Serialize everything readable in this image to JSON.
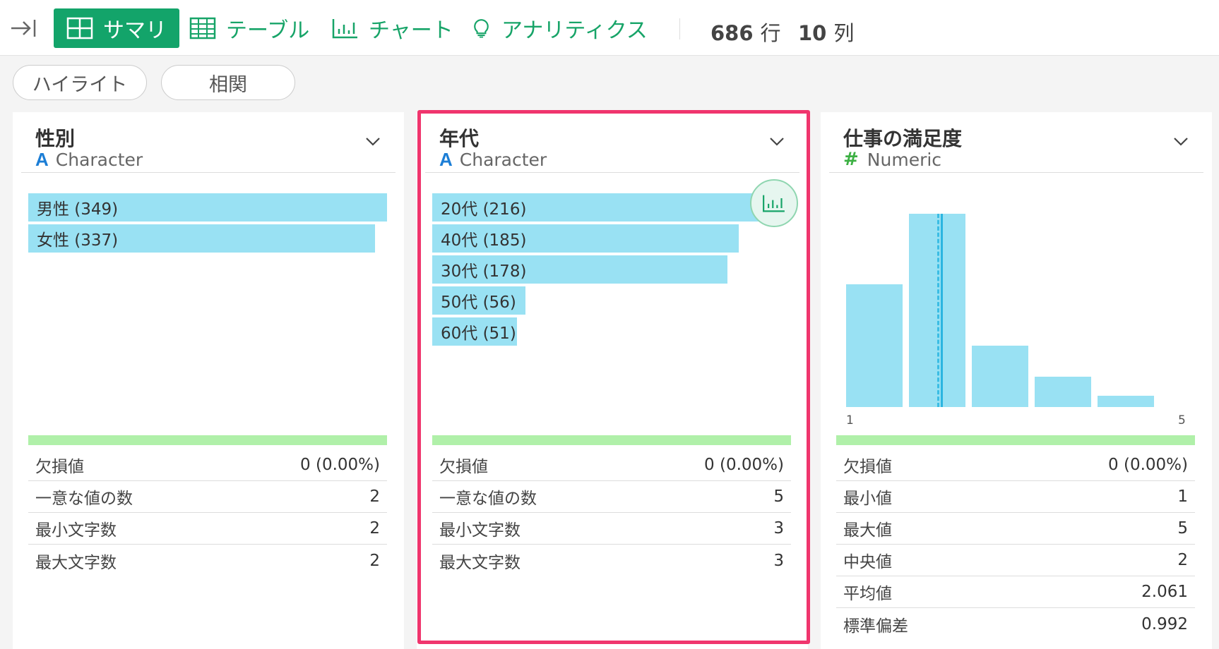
{
  "toolbar": {
    "tabs": [
      {
        "label": "サマリ",
        "icon": "summary-grid-icon"
      },
      {
        "label": "テーブル",
        "icon": "table-icon"
      },
      {
        "label": "チャート",
        "icon": "bar-chart-icon"
      },
      {
        "label": "アナリティクス",
        "icon": "lightbulb-icon"
      }
    ],
    "rows_count": "686",
    "rows_unit": "行",
    "cols_count": "10",
    "cols_unit": "列"
  },
  "pills": {
    "highlight": "ハイライト",
    "correlation": "相関"
  },
  "colors": {
    "accent": "#13a46a",
    "bar": "#99e1f3",
    "strip": "#b0f0a9",
    "highlight": "#f0356d"
  },
  "columns": [
    {
      "title": "性別",
      "type_icon": "A",
      "type_label": "Character",
      "bars": [
        {
          "label": "男性 (349)",
          "count": 349
        },
        {
          "label": "女性 (337)",
          "count": 337
        }
      ],
      "stats": [
        {
          "label": "欠損値",
          "value": "0 (0.00%)"
        },
        {
          "label": "一意な値の数",
          "value": "2"
        },
        {
          "label": "最小文字数",
          "value": "2"
        },
        {
          "label": "最大文字数",
          "value": "2"
        }
      ]
    },
    {
      "title": "年代",
      "type_icon": "A",
      "type_label": "Character",
      "bars": [
        {
          "label": "20代 (216)",
          "count": 216
        },
        {
          "label": "40代 (185)",
          "count": 185
        },
        {
          "label": "30代 (178)",
          "count": 178
        },
        {
          "label": "50代 (56)",
          "count": 56
        },
        {
          "label": "60代 (51)",
          "count": 51
        }
      ],
      "stats": [
        {
          "label": "欠損値",
          "value": "0 (0.00%)"
        },
        {
          "label": "一意な値の数",
          "value": "5"
        },
        {
          "label": "最小文字数",
          "value": "3"
        },
        {
          "label": "最大文字数",
          "value": "3"
        }
      ]
    },
    {
      "title": "仕事の満足度",
      "type_icon": "#",
      "type_label": "Numeric",
      "histogram": {
        "min_label": "1",
        "max_label": "5"
      },
      "stats": [
        {
          "label": "欠損値",
          "value": "0 (0.00%)"
        },
        {
          "label": "最小値",
          "value": "1"
        },
        {
          "label": "最大値",
          "value": "5"
        },
        {
          "label": "中央値",
          "value": "2"
        },
        {
          "label": "平均値",
          "value": "2.061"
        },
        {
          "label": "標準偏差",
          "value": "0.992"
        }
      ]
    }
  ],
  "chart_data": {
    "type": "bar",
    "categories": [
      "1",
      "2",
      "3",
      "4",
      "5"
    ],
    "values": [
      174,
      274,
      87,
      43,
      16
    ],
    "ylim": [
      0,
      274
    ],
    "markers": {
      "median": 2,
      "mean": 2.061
    }
  }
}
